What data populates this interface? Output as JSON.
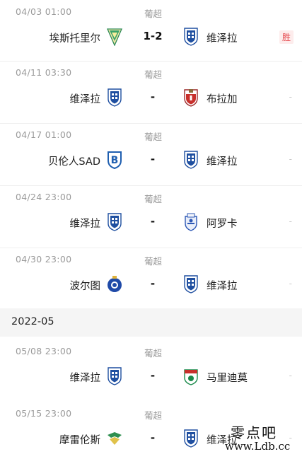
{
  "matches": [
    {
      "date": "04/03  01:00",
      "league": "葡超",
      "home": "埃斯托里尔",
      "home_badge": "estoril-crest-icon",
      "score": "1-2",
      "away": "维泽拉",
      "away_badge": "vizela-crest-icon",
      "result": "胜"
    },
    {
      "date": "04/11  03:30",
      "league": "葡超",
      "home": "维泽拉",
      "home_badge": "vizela-crest-icon",
      "score": "-",
      "away": "布拉加",
      "away_badge": "braga-crest-icon",
      "result": "-"
    },
    {
      "date": "04/17  01:00",
      "league": "葡超",
      "home": "贝伦人SAD",
      "home_badge": "belenenses-sad-crest-icon",
      "score": "-",
      "away": "维泽拉",
      "away_badge": "vizela-crest-icon",
      "result": "-"
    },
    {
      "date": "04/24  23:00",
      "league": "葡超",
      "home": "维泽拉",
      "home_badge": "vizela-crest-icon",
      "score": "-",
      "away": "阿罗卡",
      "away_badge": "arouca-crest-icon",
      "result": "-"
    },
    {
      "date": "04/30  23:00",
      "league": "葡超",
      "home": "波尔图",
      "home_badge": "porto-crest-icon",
      "score": "-",
      "away": "维泽拉",
      "away_badge": "vizela-crest-icon",
      "result": "-"
    },
    {
      "date": "05/08  23:00",
      "league": "葡超",
      "home": "维泽拉",
      "home_badge": "vizela-crest-icon",
      "score": "-",
      "away": "马里迪莫",
      "away_badge": "maritimo-crest-icon",
      "result": "-"
    },
    {
      "date": "05/15  23:00",
      "league": "葡超",
      "home": "摩雷伦斯",
      "home_badge": "moreirense-crest-icon",
      "score": "-",
      "away": "维泽拉",
      "away_badge": "vizela-crest-icon",
      "result": "-"
    }
  ],
  "month_header": "2022-05",
  "watermark": {
    "cn": "零点吧",
    "url": "www.Ldb.cc"
  },
  "colors": {
    "win": "#e5484d",
    "win_bg": "#fdecec",
    "muted": "#9a9a9a",
    "vizela_blue": "#1f4fa0"
  }
}
